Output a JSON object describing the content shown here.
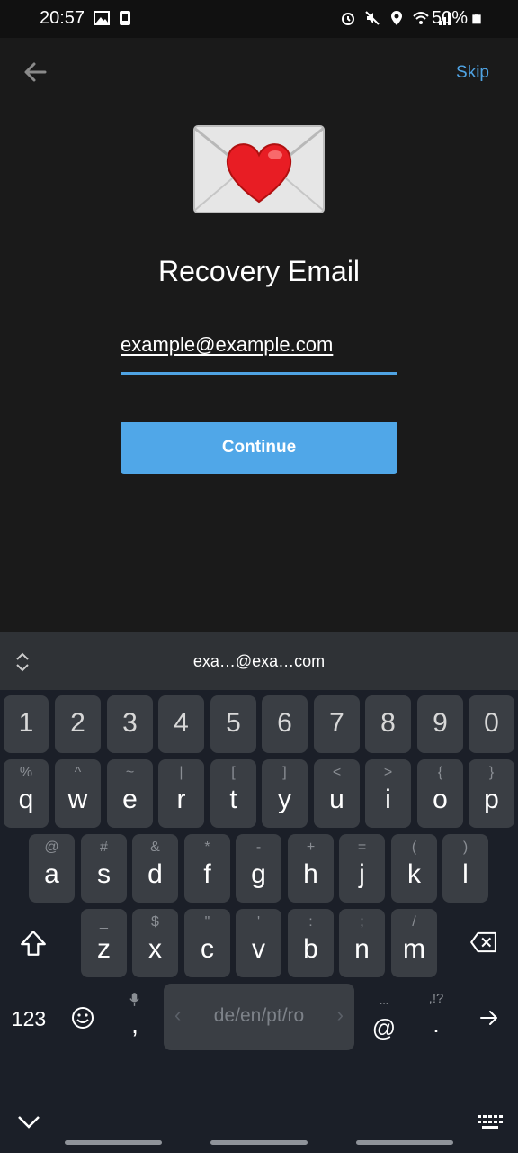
{
  "status_bar": {
    "time": "20:57",
    "battery": "50%",
    "left_icons": [
      "image-icon",
      "device-icon"
    ],
    "right_icons": [
      "alarm-icon",
      "mute-icon",
      "location-icon",
      "wifi-icon",
      "signal-icon",
      "battery-icon"
    ]
  },
  "app_bar": {
    "skip_label": "Skip"
  },
  "main": {
    "title": "Recovery Email",
    "email_value": "example@example.com",
    "continue_label": "Continue"
  },
  "keyboard": {
    "suggestion": "exa…@exa…com",
    "numbers": [
      "1",
      "2",
      "3",
      "4",
      "5",
      "6",
      "7",
      "8",
      "9",
      "0"
    ],
    "row1": [
      {
        "k": "q",
        "s": "%"
      },
      {
        "k": "w",
        "s": "^"
      },
      {
        "k": "e",
        "s": "~"
      },
      {
        "k": "r",
        "s": "|"
      },
      {
        "k": "t",
        "s": "["
      },
      {
        "k": "y",
        "s": "]"
      },
      {
        "k": "u",
        "s": "<"
      },
      {
        "k": "i",
        "s": ">"
      },
      {
        "k": "o",
        "s": "{"
      },
      {
        "k": "p",
        "s": "}"
      }
    ],
    "row2": [
      {
        "k": "a",
        "s": "@"
      },
      {
        "k": "s",
        "s": "#"
      },
      {
        "k": "d",
        "s": "&"
      },
      {
        "k": "f",
        "s": "*"
      },
      {
        "k": "g",
        "s": "-"
      },
      {
        "k": "h",
        "s": "+"
      },
      {
        "k": "j",
        "s": "="
      },
      {
        "k": "k",
        "s": "("
      },
      {
        "k": "l",
        "s": ")"
      }
    ],
    "row3": [
      {
        "k": "z",
        "s": "_"
      },
      {
        "k": "x",
        "s": "$"
      },
      {
        "k": "c",
        "s": "\""
      },
      {
        "k": "v",
        "s": "'"
      },
      {
        "k": "b",
        "s": ":"
      },
      {
        "k": "n",
        "s": ";"
      },
      {
        "k": "m",
        "s": "/"
      }
    ],
    "key_123": "123",
    "comma": ",",
    "space_label": "de/en/pt/ro",
    "at": "@",
    "at_hint": "...",
    "period": ".",
    "period_hint": ",!?"
  },
  "colors": {
    "accent": "#4fa3e3",
    "button": "#50a7e8",
    "background": "#1a1a1a",
    "key": "#3a3e44"
  }
}
